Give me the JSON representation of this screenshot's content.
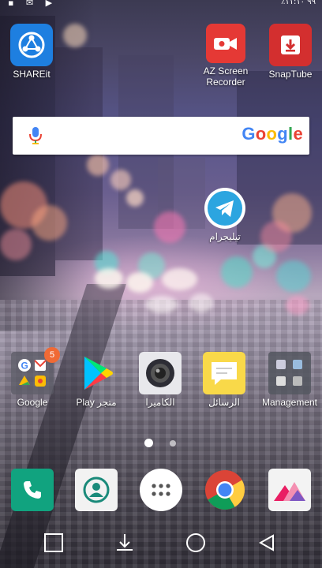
{
  "status_bar": {
    "right_text": "٪٩٩ ١١:١٠"
  },
  "top_apps": [
    {
      "label": "SHAREit",
      "icon": "shareit-icon"
    },
    {
      "label": "AZ Screen Recorder",
      "icon": "camcorder-icon"
    },
    {
      "label": "SnapTube",
      "icon": "download-icon"
    }
  ],
  "search": {
    "logo": "Google",
    "colors": {
      "blue": "#4285F4",
      "red": "#EA4335",
      "yellow": "#FBBC05",
      "green": "#34A853"
    }
  },
  "telegram": {
    "label": "تيليجرام",
    "icon": "paper-plane-icon"
  },
  "home_apps": [
    {
      "label": "Google",
      "badge": "5",
      "icon": "google-folder-icon"
    },
    {
      "label": "Play متجر",
      "icon": "play-store-icon"
    },
    {
      "label": "الكاميرا",
      "icon": "camera-icon"
    },
    {
      "label": "الرسائل",
      "icon": "message-icon"
    },
    {
      "label": "Management",
      "icon": "management-folder-icon"
    }
  ],
  "page_indicator": {
    "pages": 2,
    "current": 1
  },
  "dock": [
    {
      "name": "phone",
      "icon": "phone-icon"
    },
    {
      "name": "contacts",
      "icon": "contacts-icon"
    },
    {
      "name": "apps",
      "icon": "app-drawer-icon"
    },
    {
      "name": "chrome",
      "icon": "chrome-icon"
    },
    {
      "name": "gallery",
      "icon": "gallery-icon"
    }
  ],
  "nav": [
    {
      "name": "recent-apps",
      "icon": "square-icon"
    },
    {
      "name": "notifications-pulldown",
      "icon": "arrow-down-icon"
    },
    {
      "name": "home",
      "icon": "circle-icon"
    },
    {
      "name": "back",
      "icon": "triangle-back-icon"
    }
  ]
}
